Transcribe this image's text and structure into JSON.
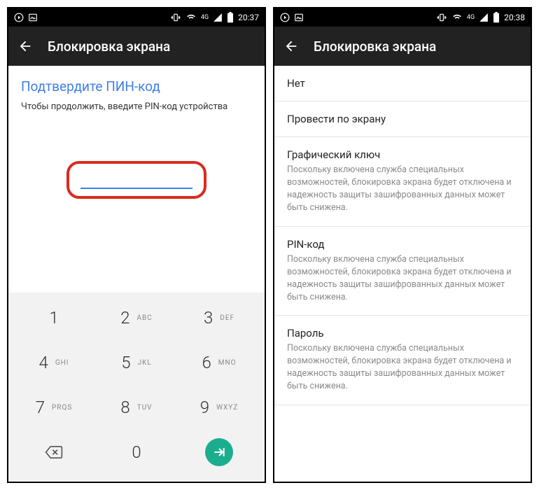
{
  "left": {
    "status": {
      "time": "20:37",
      "net": "4G"
    },
    "appbar": {
      "title": "Блокировка экрана"
    },
    "confirm_title": "Подтвердите ПИН-код",
    "confirm_sub": "Чтобы продолжить, введите PIN-код устройства",
    "keypad": {
      "k1": "1",
      "k2": "2",
      "l2": "ABC",
      "k3": "3",
      "l3": "DEF",
      "k4": "4",
      "l4": "GHI",
      "k5": "5",
      "l5": "JKL",
      "k6": "6",
      "l6": "MNO",
      "k7": "7",
      "l7": "PRQS",
      "k8": "8",
      "l8": "TUV",
      "k9": "9",
      "l9": "WXYZ",
      "k0": "0"
    }
  },
  "right": {
    "status": {
      "time": "20:38",
      "net": "4G"
    },
    "appbar": {
      "title": "Блокировка экрана"
    },
    "options": [
      {
        "title": "Нет"
      },
      {
        "title": "Провести по экрану"
      },
      {
        "title": "Графический ключ",
        "sub": "Поскольку включена служба специальных возможностей, блокировка экрана будет отключена и надежность защиты зашифрованных данных может быть снижена."
      },
      {
        "title": "PIN-код",
        "sub": "Поскольку включена служба специальных возможностей, блокировка экрана будет отключена и надежность защиты зашифрованных данных может быть снижена."
      },
      {
        "title": "Пароль",
        "sub": "Поскольку включена служба специальных возможностей, блокировка экрана будет отключена и надежность защиты зашифрованных данных может быть снижена."
      }
    ]
  }
}
